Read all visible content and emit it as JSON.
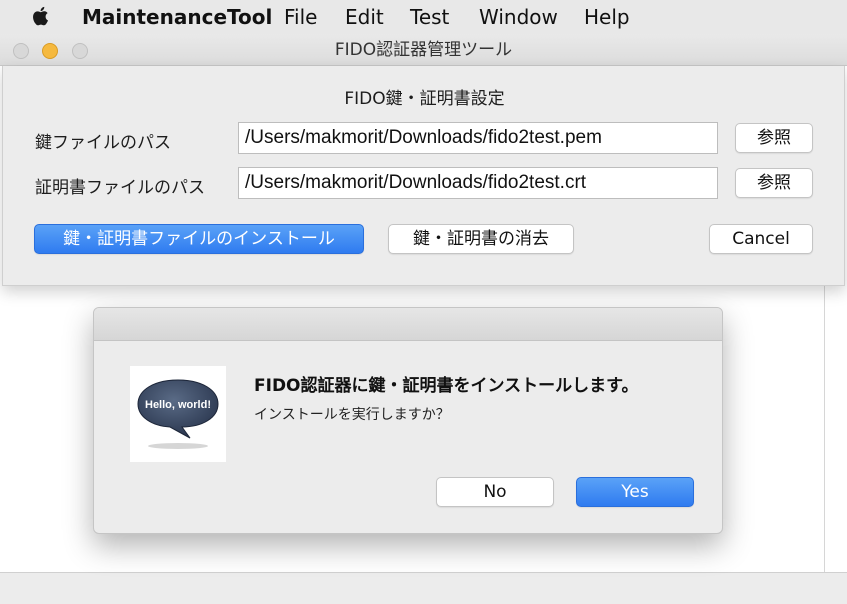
{
  "menubar": {
    "app_name": "MaintenanceTool",
    "items": [
      "File",
      "Edit",
      "Test",
      "Window",
      "Help"
    ]
  },
  "window": {
    "title": "FIDO認証器管理ツール"
  },
  "settings": {
    "heading": "FIDO鍵・証明書設定",
    "key_label": "鍵ファイルのパス",
    "key_path": "/Users/makmorit/Downloads/fido2test.pem",
    "cert_label": "証明書ファイルのパス",
    "cert_path": "/Users/makmorit/Downloads/fido2test.crt",
    "browse_label": "参照",
    "install_label": "鍵・証明書ファイルのインストール",
    "erase_label": "鍵・証明書の消去",
    "cancel_label": "Cancel"
  },
  "dialog": {
    "icon_text": "Hello, world!",
    "message": "FIDO認証器に鍵・証明書をインストールします。",
    "informative": "インストールを実行しますか？",
    "no_label": "No",
    "yes_label": "Yes"
  },
  "colors": {
    "accent_blue": "#2f7bf0",
    "minimize_yellow": "#f5b93f",
    "speech_bubble": "#3a4a63"
  },
  "icons": [
    "apple-icon",
    "hello-world-bubble-icon"
  ]
}
